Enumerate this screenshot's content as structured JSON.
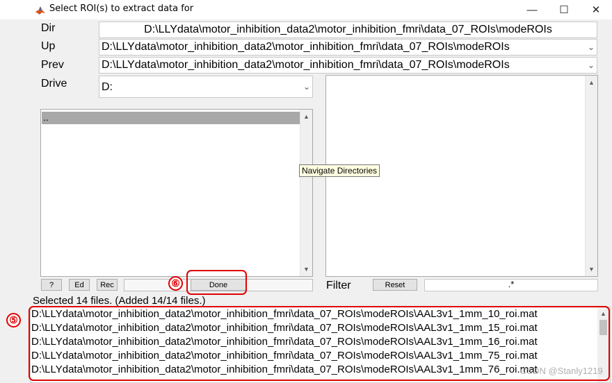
{
  "window": {
    "title": "Select ROI(s) to extract data for",
    "minimize_glyph": "—",
    "maximize_glyph": "☐",
    "close_glyph": "✕"
  },
  "labels": {
    "dir": "Dir",
    "up": "Up",
    "prev": "Prev",
    "drive": "Drive",
    "filter": "Filter"
  },
  "dir_value": "D:\\LLYdata\\motor_inhibition_data2\\motor_inhibition_fmri\\data_07_ROIs\\modeROIs",
  "up_value": "D:\\LLYdata\\motor_inhibition_data2\\motor_inhibition_fmri\\data_07_ROIs\\modeROIs",
  "prev_value": "D:\\LLYdata\\motor_inhibition_data2\\motor_inhibition_fmri\\data_07_ROIs\\modeROIs",
  "drive_value": "D:",
  "dir_list": {
    "items": [
      ".."
    ]
  },
  "tooltip": "Navigate Directories",
  "buttons": {
    "help": "?",
    "ed": "Ed",
    "rec": "Rec",
    "done": "Done",
    "reset": "Reset"
  },
  "filter_value": ".*",
  "status": "Selected 14 files. (Added 14/14 files.)",
  "selected_files": [
    "D:\\LLYdata\\motor_inhibition_data2\\motor_inhibition_fmri\\data_07_ROIs\\modeROIs\\AAL3v1_1mm_10_roi.mat",
    "D:\\LLYdata\\motor_inhibition_data2\\motor_inhibition_fmri\\data_07_ROIs\\modeROIs\\AAL3v1_1mm_15_roi.mat",
    "D:\\LLYdata\\motor_inhibition_data2\\motor_inhibition_fmri\\data_07_ROIs\\modeROIs\\AAL3v1_1mm_16_roi.mat",
    "D:\\LLYdata\\motor_inhibition_data2\\motor_inhibition_fmri\\data_07_ROIs\\modeROIs\\AAL3v1_1mm_75_roi.mat",
    "D:\\LLYdata\\motor_inhibition_data2\\motor_inhibition_fmri\\data_07_ROIs\\modeROIs\\AAL3v1_1mm_76_roi.mat"
  ],
  "annotations": {
    "marker_5": "⑤",
    "marker_6": "⑥"
  },
  "watermark": "CSDN @Stanly1219",
  "icons": {
    "dropdown": "chevron-down-icon",
    "scroll_up": "triangle-up-icon",
    "scroll_down": "triangle-down-icon"
  },
  "colors": {
    "callout": "#e00000",
    "selection": "#a8a8a8",
    "tooltip_bg": "#ffffe1"
  }
}
